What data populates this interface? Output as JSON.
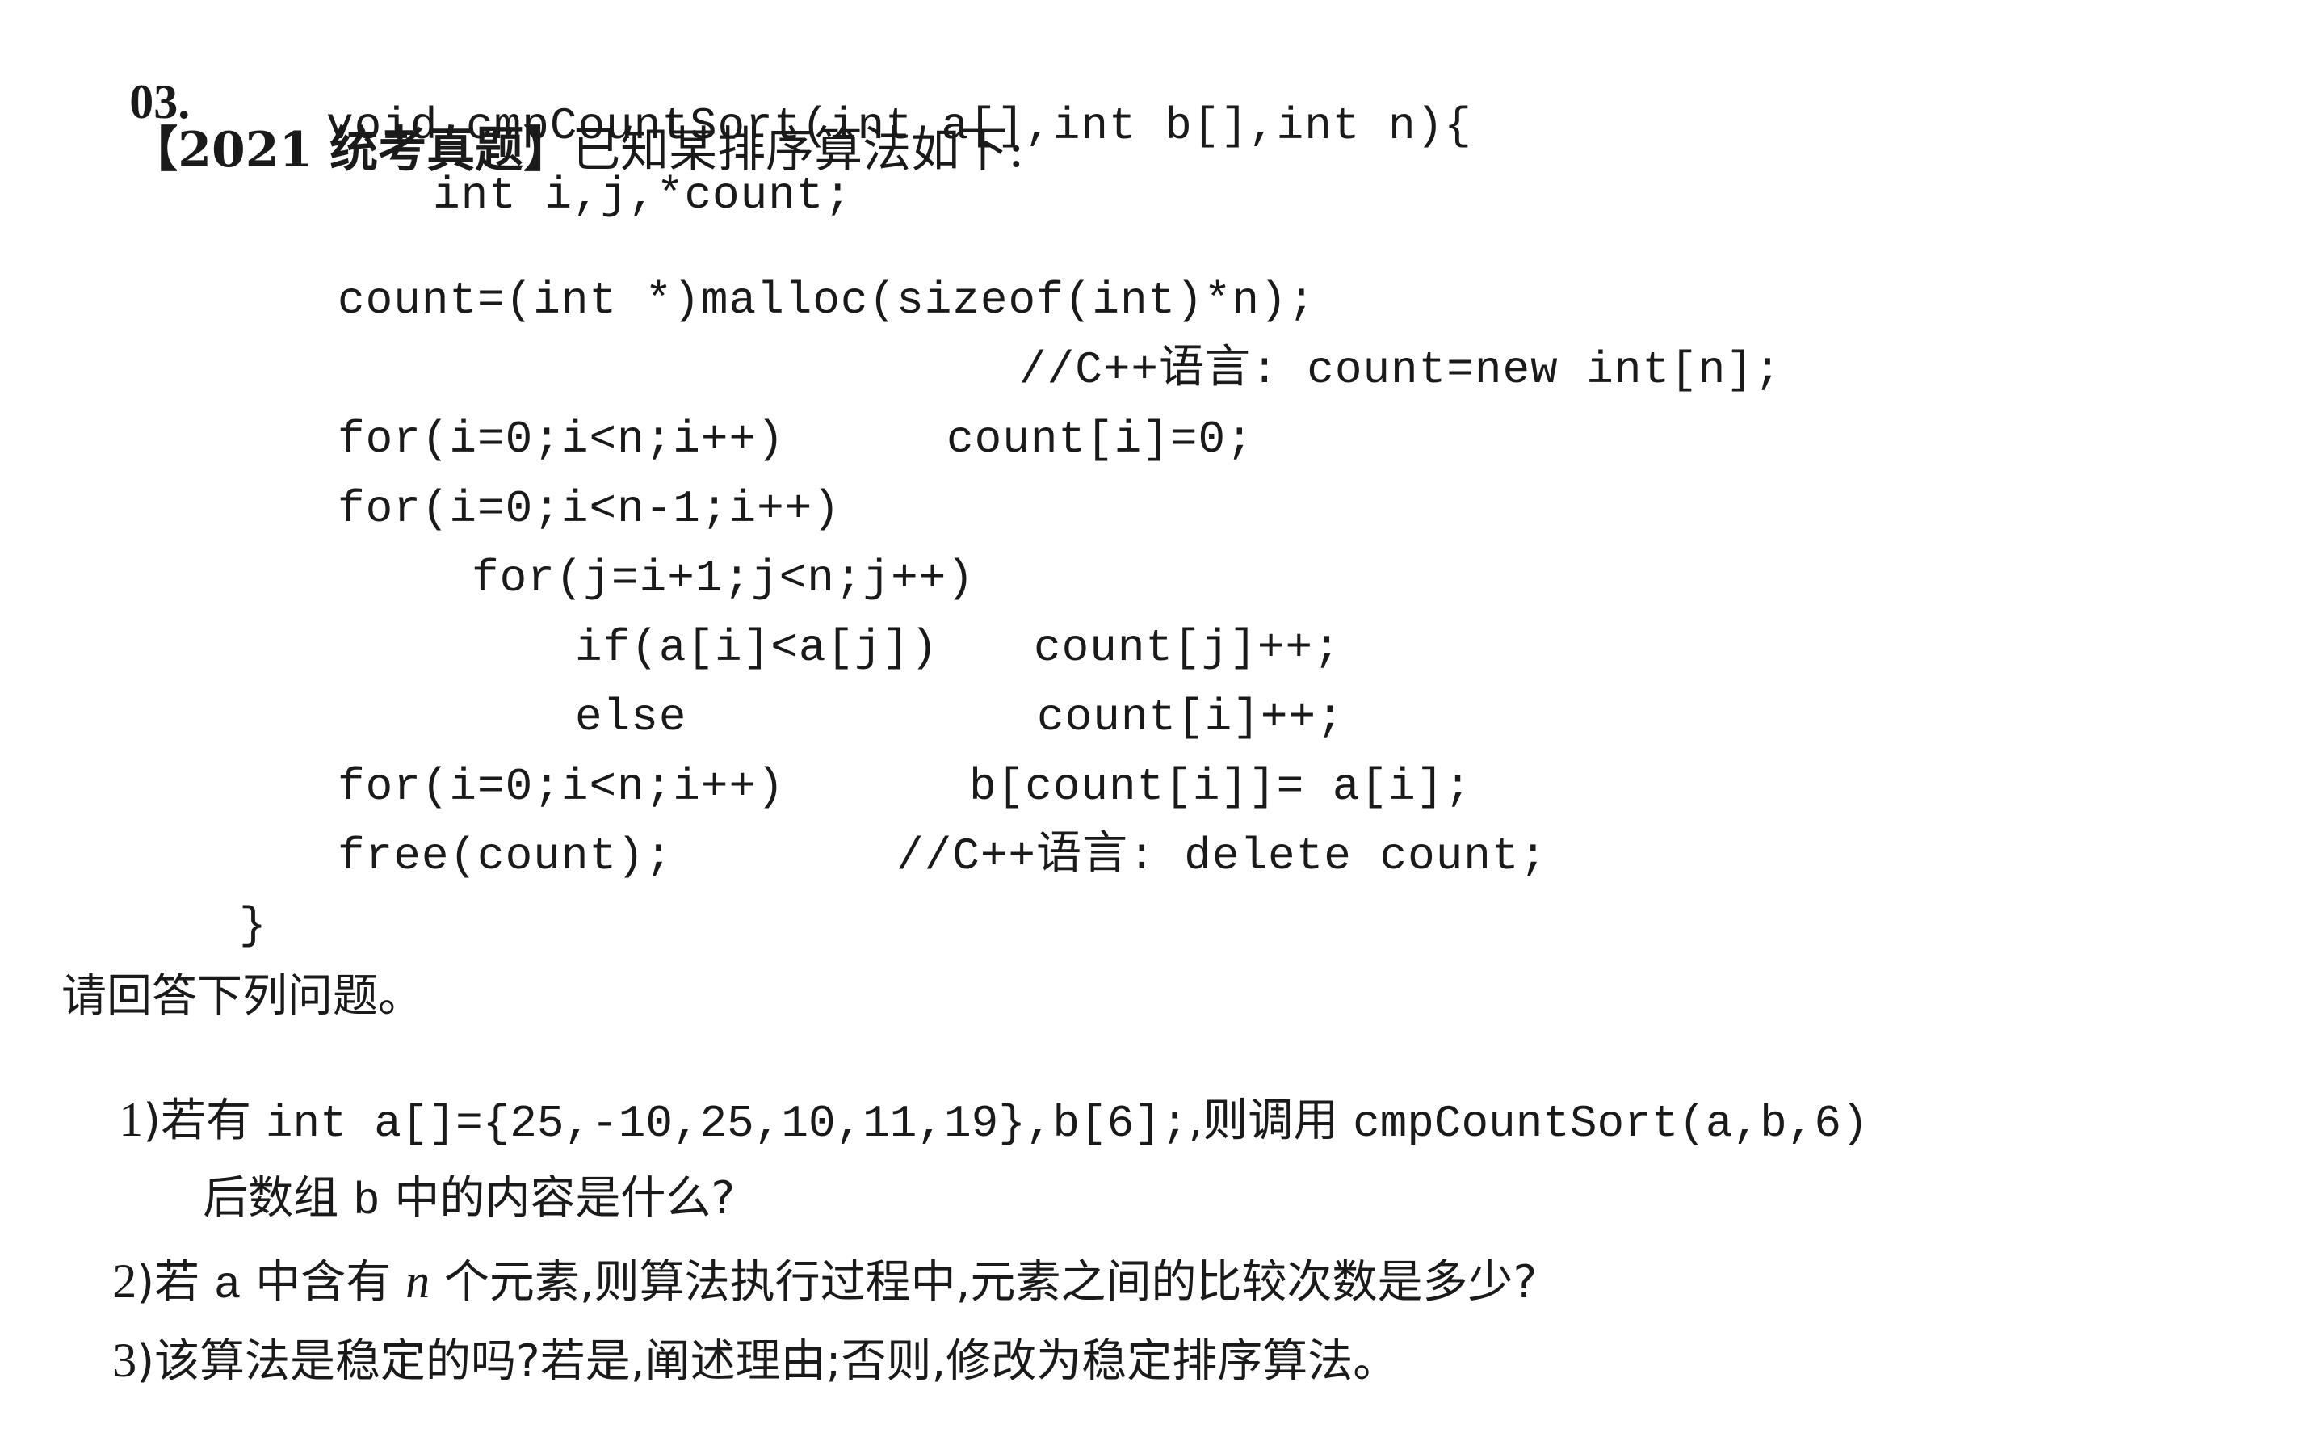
{
  "question": {
    "number": "03.",
    "tag": "【2021 统考真题】",
    "intro": "已知某排序算法如下:"
  },
  "code": {
    "line1": "void cmpCountSort(int a[],int b[],int n){",
    "line2": "int i,j,*count;",
    "line3": "count=(int *)malloc(sizeof(int)*n);",
    "line4": "//C++语言: count=new int[n];",
    "line5a": "for(i=0;i<n;i++)",
    "line5b": "count[i]=0;",
    "line6": "for(i=0;i<n-1;i++)",
    "line7": "for(j=i+1;j<n;j++)",
    "line8a": "if(a[i]<a[j])",
    "line8b": "count[j]++;",
    "line9a": "else",
    "line9b": "count[i]++;",
    "line10a": "for(i=0;i<n;i++)",
    "line10b": "b[count[i]]= a[i];",
    "line11a": "free(count);",
    "line11b": "//C++语言: delete count;",
    "line12": "}"
  },
  "prompt": "请回答下列问题。",
  "questions": {
    "q1": {
      "num": "1",
      "pre": ")若有 ",
      "code1": "int a[]={25,-10,25,10,11,19},b[6];",
      "mid": ",则调用 ",
      "code2": "cmpCountSort(a,b,6)",
      "cont_pre": "后数组 ",
      "cont_code": "b",
      "cont_post": " 中的内容是什么?"
    },
    "q2": {
      "num": "2",
      "pre": ")若 ",
      "code": "a",
      "mid": " 中含有 ",
      "var": "n",
      "post": " 个元素,则算法执行过程中,元素之间的比较次数是多少?"
    },
    "q3": {
      "num": "3",
      "text": ")该算法是稳定的吗?若是,阐述理由;否则,修改为稳定排序算法。"
    }
  }
}
